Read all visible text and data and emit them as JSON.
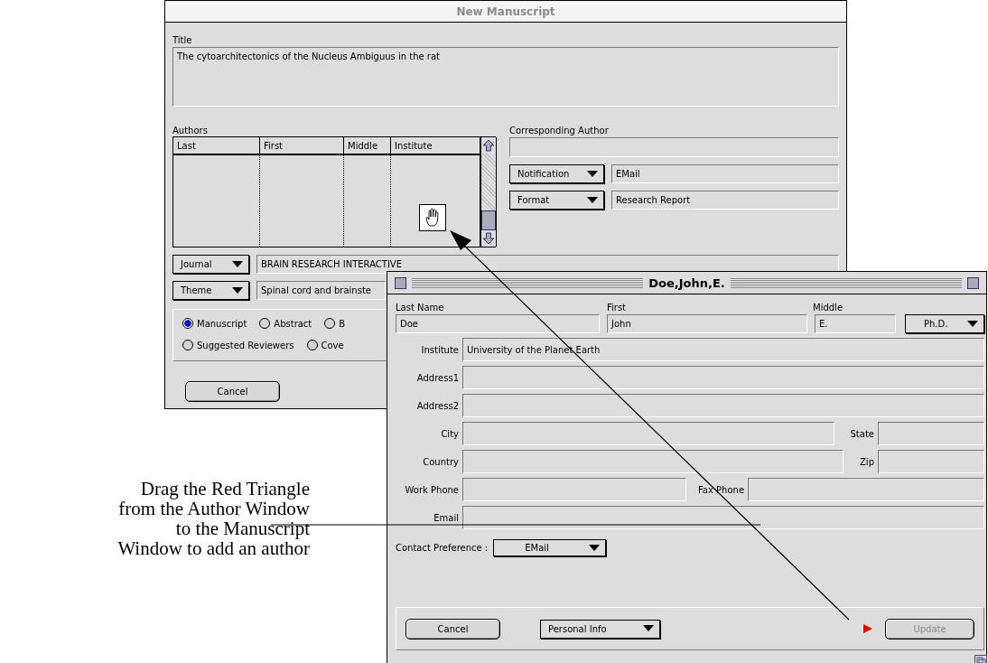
{
  "manuscript_window": {
    "title": "New Manuscript",
    "title_label": "Title",
    "title_value": "The cytoarchitectonics of the Nucleus Ambiguus in the rat",
    "authors_label": "Authors",
    "author_columns": [
      "Last",
      "First",
      "Middle",
      "Institute"
    ],
    "corresponding_label": "Corresponding Author",
    "popups": [
      {
        "label": "Notification",
        "value": "EMail"
      },
      {
        "label": "Format",
        "value": "Research Report"
      }
    ],
    "journal": {
      "label": "Journal",
      "value": "BRAIN RESEARCH INTERACTIVE"
    },
    "theme": {
      "label": "Theme",
      "value": "Spinal cord and brainste"
    },
    "radio_rows": [
      [
        {
          "label": "Manuscript",
          "selected": true
        },
        {
          "label": "Abstract",
          "selected": false
        },
        {
          "label": "B",
          "selected": false
        }
      ],
      [
        {
          "label": "Suggested Reviewers",
          "selected": false
        },
        {
          "label": "Cove",
          "selected": false
        }
      ]
    ],
    "cancel_button": "Cancel"
  },
  "author_window": {
    "title": "Doe,John,E.",
    "name_fields": [
      {
        "label": "Last Name",
        "value": "Doe"
      },
      {
        "label": "First",
        "value": "John"
      },
      {
        "label": "Middle",
        "value": "E."
      }
    ],
    "degree": "Ph.D.",
    "rows": [
      {
        "kind": "single",
        "fields": [
          {
            "label": "Institute",
            "value": "University of the Planet Earth"
          }
        ]
      },
      {
        "kind": "single",
        "fields": [
          {
            "label": "Address1"
          }
        ]
      },
      {
        "kind": "single",
        "fields": [
          {
            "label": "Address2"
          }
        ]
      },
      {
        "kind": "pair",
        "fields": [
          {
            "label": "City"
          },
          {
            "label": "State"
          }
        ]
      },
      {
        "kind": "pair",
        "fields": [
          {
            "label": "Country"
          },
          {
            "label": "Zip"
          }
        ]
      },
      {
        "kind": "half",
        "fields": [
          {
            "label": "Work Phone"
          },
          {
            "label": "Fax Phone"
          }
        ]
      },
      {
        "kind": "single",
        "fields": [
          {
            "label": "Email"
          }
        ]
      }
    ],
    "contact_preference": {
      "label": "Contact Preference :",
      "value": "EMail"
    },
    "cancel_button": "Cancel",
    "info_popup": "Personal Info",
    "update_button": {
      "label": "Update",
      "disabled": true
    }
  },
  "caption": [
    "Drag the Red Triangle",
    "from the Author Window",
    "to the Manuscript",
    "Window to add an author"
  ]
}
